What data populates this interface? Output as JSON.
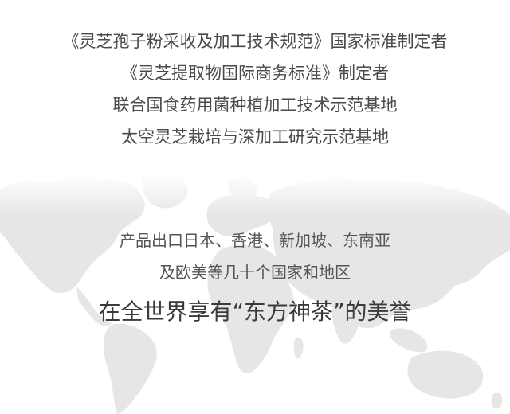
{
  "credentials": [
    "《灵芝孢子粉采收及加工技术规范》国家标准制定者",
    "《灵芝提取物国际商务标准》制定者",
    "联合国食药用菌种植加工技术示范基地",
    "太空灵芝栽培与深加工研究示范基地"
  ],
  "export": {
    "line1": "产品出口日本、香港、新加坡、东南亚",
    "line2": "及欧美等几十个国家和地区",
    "reputation": "在全世界享有“东方神茶”的美誉"
  },
  "colors": {
    "background": "#ffffff",
    "text": "#4a4a4a",
    "map": "#e9e9e9"
  },
  "icons": {
    "background_graphic": "world-map"
  }
}
